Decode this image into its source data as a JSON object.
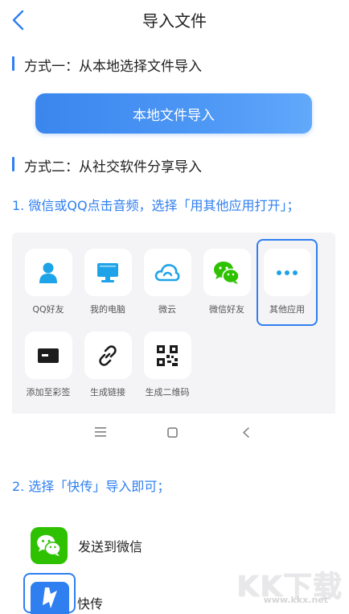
{
  "header": {
    "title": "导入文件"
  },
  "method1": {
    "title": "方式一：从本地选择文件导入",
    "button_label": "本地文件导入"
  },
  "method2": {
    "title": "方式二：从社交软件分享导入"
  },
  "step1": {
    "text": "1. 微信或QQ点击音频，选择「用其他应用打开」；"
  },
  "share_panel": {
    "items": [
      {
        "label": "QQ好友",
        "icon": "person-icon"
      },
      {
        "label": "我的电脑",
        "icon": "monitor-icon"
      },
      {
        "label": "微云",
        "icon": "cloud-icon"
      },
      {
        "label": "微信好友",
        "icon": "wechat-icon"
      },
      {
        "label": "其他应用",
        "icon": "more-icon"
      },
      {
        "label": "添加至彩签",
        "icon": "tag-icon"
      },
      {
        "label": "生成链接",
        "icon": "link-icon"
      },
      {
        "label": "生成二维码",
        "icon": "qrcode-icon"
      }
    ]
  },
  "step2": {
    "text": "2. 选择「快传」导入即可；"
  },
  "apps": [
    {
      "label": "发送到微信",
      "icon": "wechat-icon",
      "color": "#2dc100"
    },
    {
      "label": "快传",
      "icon": "kuaichuan-icon",
      "color": "#2f7ff0"
    }
  ],
  "watermark": {
    "brand": "KK下载",
    "url": "www.kkx.net"
  },
  "colors": {
    "accent": "#2f7ff0",
    "panel_bg": "#f4f4f6"
  }
}
